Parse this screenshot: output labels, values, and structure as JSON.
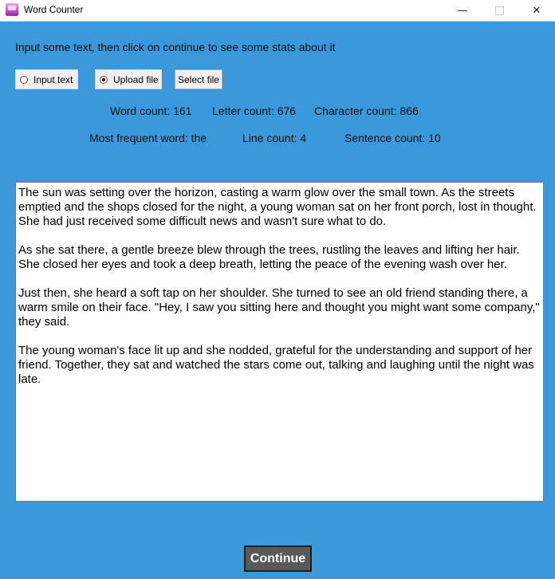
{
  "window": {
    "title": "Word Counter",
    "icon": "word-counter-app-icon",
    "controls": {
      "minimize": "—",
      "maximize": "□",
      "close": "✕"
    }
  },
  "instructions": "Input some text, then click on continue to see some stats about it",
  "mode": {
    "options": [
      {
        "label": "Input text",
        "selected": false
      },
      {
        "label": "Upload file",
        "selected": true
      }
    ],
    "select_file_label": "Select file"
  },
  "stats": {
    "word_count": "Word count: 161",
    "letter_count": "Letter count: 676",
    "character_count": "Character count: 866",
    "most_frequent_word": "Most frequent word: the",
    "line_count": "Line count: 4",
    "sentence_count": "Sentence count: 10"
  },
  "text": {
    "paragraphs": [
      "The sun was setting over the horizon, casting a warm glow over the small town. As the streets emptied and the shops closed for the night, a young woman sat on her front porch, lost in thought. She had just received some difficult news and wasn't sure what to do.",
      "As she sat there, a gentle breeze blew through the trees, rustling the leaves and lifting her hair. She closed her eyes and took a deep breath, letting the peace of the evening wash over her.",
      "Just then, she heard a soft tap on her shoulder. She turned to see an old friend standing there, a warm smile on their face. \"Hey, I saw you sitting here and thought you might want some company,\" they said.",
      "The young woman's face lit up and she nodded, grateful for the understanding and support of her friend. Together, they sat and watched the stars come out, talking and laughing until the night was late."
    ]
  },
  "continue_label": "Continue",
  "colors": {
    "background": "#3a98db",
    "button_dark": "#595959"
  }
}
